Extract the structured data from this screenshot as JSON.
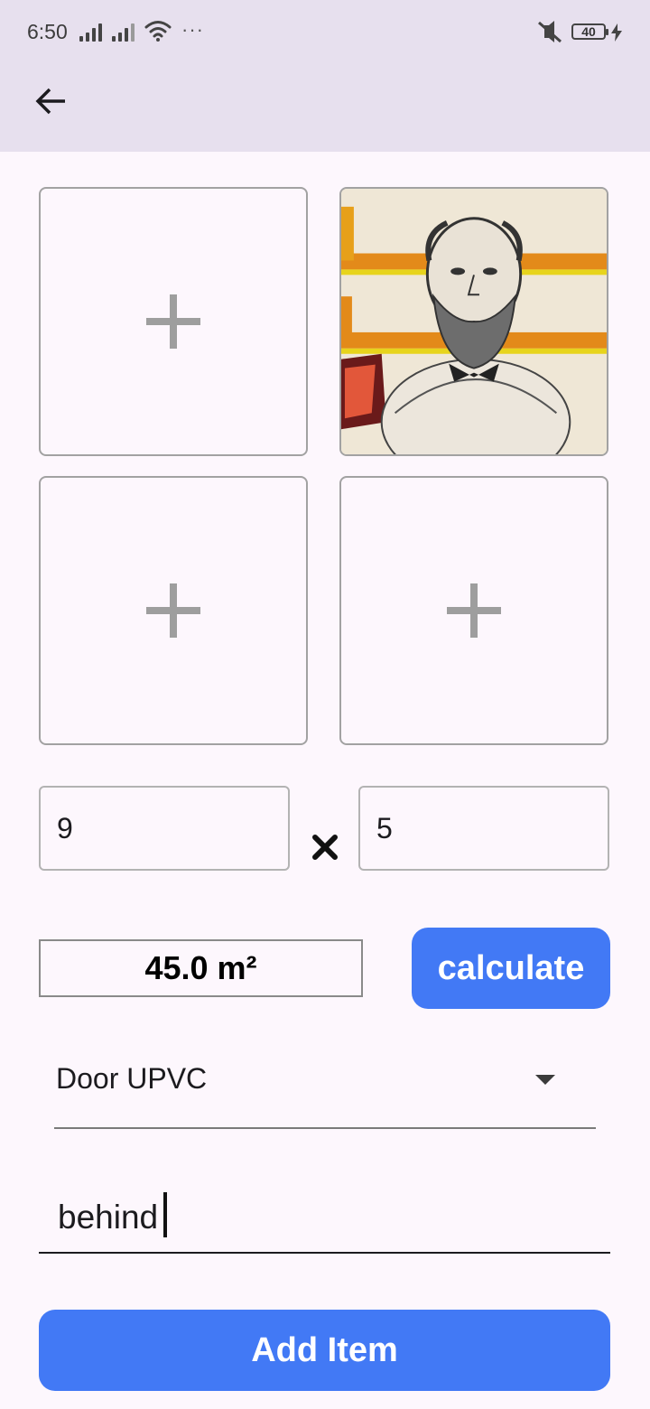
{
  "status_bar": {
    "time": "6:50",
    "battery": "40",
    "icons": [
      "signal-icon",
      "signal-icon",
      "wifi-icon",
      "more-dots-icon",
      "mute-icon",
      "battery-icon",
      "charging-bolt-icon"
    ]
  },
  "app_bar": {
    "back_icon": "arrow-back-icon"
  },
  "images": {
    "add_icon": "plus-icon",
    "slots": [
      "empty",
      "portrait-photo",
      "empty",
      "empty"
    ]
  },
  "dimensions": {
    "width_value": "9",
    "height_value": "5",
    "operator_icon": "multiply-icon"
  },
  "result": {
    "area": "45.0 m²"
  },
  "actions": {
    "calculate_label": "calculate",
    "add_item_label": "Add Item"
  },
  "item_type": {
    "selected": "Door UPVC"
  },
  "note": {
    "value": "behind"
  },
  "colors": {
    "primary": "#4279f5",
    "app_bar": "#e7e0ee",
    "background": "#fdf7fd"
  }
}
